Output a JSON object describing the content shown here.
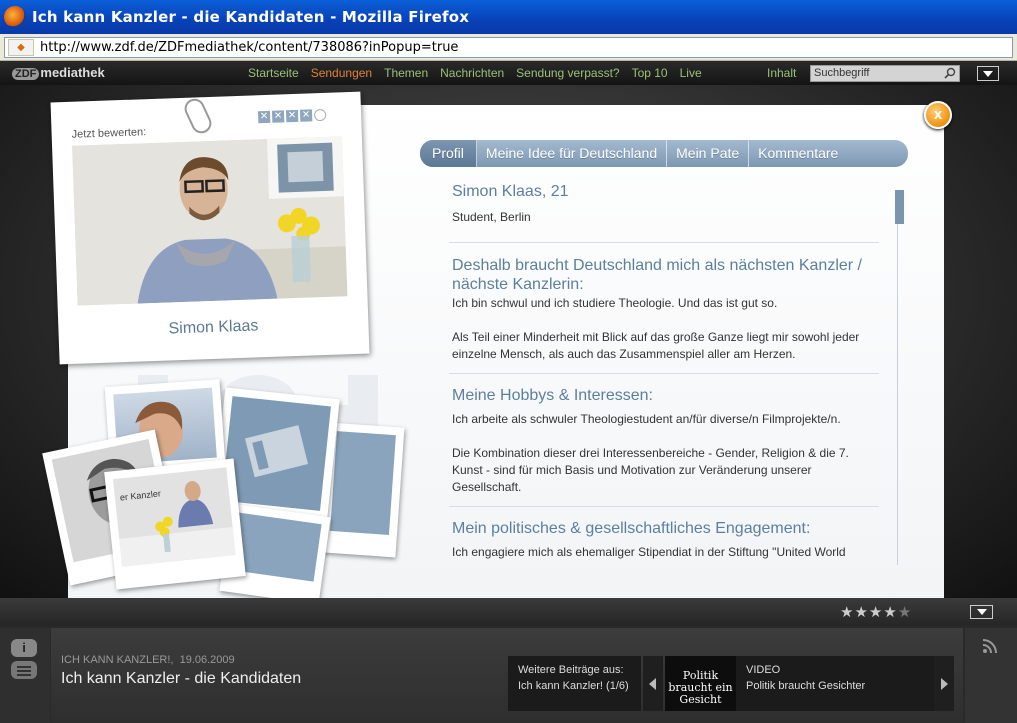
{
  "window": {
    "title": "Ich kann Kanzler - die Kandidaten - Mozilla Firefox"
  },
  "address": {
    "url": "http://www.zdf.de/ZDFmediathek/content/738086?inPopup=true"
  },
  "nav": {
    "logo_zdf": "ZDF",
    "logo_text": "mediathek",
    "links": [
      "Startseite",
      "Sendungen",
      "Themen",
      "Nachrichten",
      "Sendung verpasst?",
      "Top 10",
      "Live"
    ],
    "inhalt": "Inhalt",
    "search_value": "Suchbegriff"
  },
  "card": {
    "rate_label": "Jetzt bewerten:",
    "stars_filled": 4,
    "stars_total": 5,
    "name": "Simon Klaas"
  },
  "close": {
    "label": "x"
  },
  "tabs": [
    "Profil",
    "Meine Idee für Deutschland",
    "Mein Pate",
    "Kommentare"
  ],
  "profile": {
    "heading": "Simon Klaas, 21",
    "subtitle": "Student, Berlin",
    "sec1_title": "Deshalb braucht Deutschland mich als nächsten Kanzler / nächste Kanzlerin:",
    "sec1_p1": "Ich bin schwul und ich studiere Theologie. Und das ist gut so.",
    "sec1_p2": "Als Teil einer Minderheit mit Blick auf das große Ganze liegt mir sowohl jeder einzelne Mensch, als auch das Zusammenspiel aller am Herzen.",
    "sec2_title": "Meine Hobbys & Interessen:",
    "sec2_p1": "Ich arbeite als schwuler Theologiestudent an/für diverse/n Filmprojekte/n.",
    "sec2_p2": "Die Kombination dieser drei Interessenbereiche - Gender, Religion & die 7. Kunst - sind für mich Basis und Motivation zur Veränderung unserer Gesellschaft.",
    "sec3_title": "Mein politisches & gesellschaftliches Engagement:",
    "sec3_p1": "Ich engagiere mich als ehemaliger Stipendiat in der Stiftung \"United World"
  },
  "collage": {
    "sign_text": "er Kanzler"
  },
  "bottom": {
    "rating": 4,
    "rating_total": 5,
    "info_label": "i",
    "meta_show": "ICH KANN KANZLER!,",
    "meta_date": "19.06.2009",
    "title": "Ich kann Kanzler - die Kandidaten",
    "weitere_label": "Weitere Beiträge aus:",
    "weitere_value": "Ich kann Kanzler!  (1/6)",
    "thumb_text": "Politik braucht ein Gesicht",
    "video_label": "VIDEO",
    "video_title": "Politik braucht Gesichter"
  },
  "colors": {
    "accent": "#5c7f9e",
    "tab": "#8ea6bf",
    "close": "#f29a1a",
    "nav_link": "#9ac07a",
    "nav_active": "#e0803a"
  }
}
